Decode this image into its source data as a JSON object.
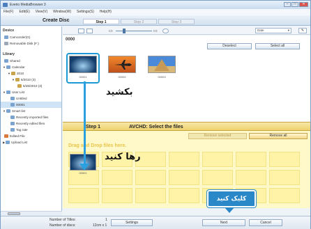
{
  "window": {
    "title": "Everio MediaBrowser 3"
  },
  "menu": [
    "File(F)",
    "Edit(E)",
    "View(V)",
    "Window(W)",
    "Settings(S)",
    "Help(H)"
  ],
  "header": {
    "title": "Create Disc",
    "steps": [
      "Step 1",
      "Step 2",
      "Step 3"
    ]
  },
  "sidebar": {
    "device_heading": "Device",
    "devices": [
      "Camcorder(G)",
      "Removable Disk (F:)"
    ],
    "library_heading": "Library",
    "items": [
      "Shared",
      "Calendar",
      "2010",
      "5/2010 (3)",
      "5/28/2010 (3)",
      "User List",
      "Untitled",
      "00001",
      "Smart list",
      "Recently imported files",
      "Recently edited files",
      "Tag rate",
      "Edited File",
      "Upload List"
    ]
  },
  "toolbar": {
    "sort_value": "Date"
  },
  "browser": {
    "folder": "0000",
    "deselect_label": "Deselect",
    "select_all_label": "Select all",
    "thumb_labels": [
      "00001",
      "00002",
      "00003"
    ],
    "annot_drag": "بکشید"
  },
  "step_bar": {
    "step": "Step 1",
    "instruction": "AVCHD: Select the files"
  },
  "drop": {
    "remove_selected_label": "Remove selected",
    "remove_all_label": "Remove all",
    "hint": "Drag and Drop files here.",
    "dropped_label": "00001",
    "annot_drop": "رها کنید"
  },
  "bottom": {
    "titles_label": "Number of Titles:",
    "titles_value": "1",
    "discs_label": "Number of discs:",
    "discs_value": "12cm x 1",
    "settings_label": "Settings",
    "next_label": "Next",
    "cancel_label": "Cancel"
  },
  "callout": {
    "text": "کلیک کنید"
  },
  "colors": {
    "accent": "#2aa0e0",
    "callout_bg": "#2a88c8",
    "drop_bg": "#fff8c8",
    "step_bar": "#efd26e"
  }
}
